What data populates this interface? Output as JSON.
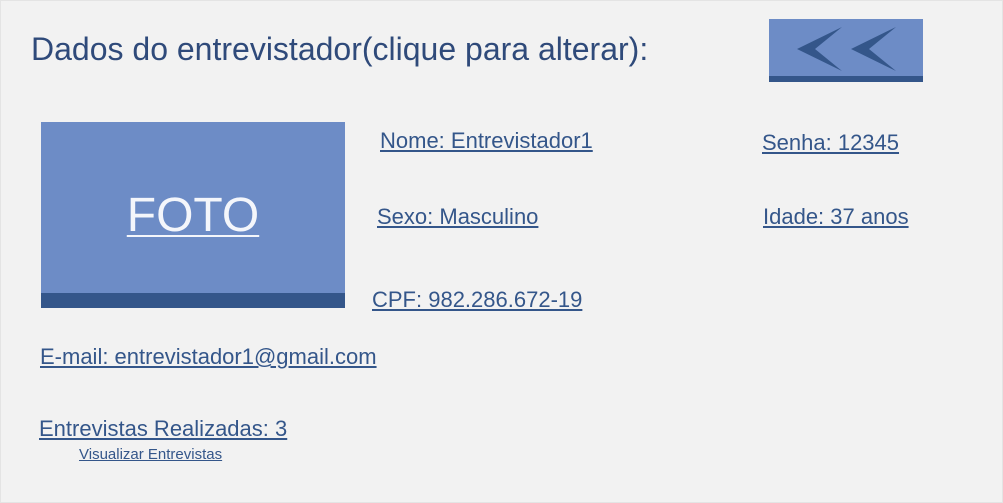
{
  "header": {
    "title": "Dados do entrevistador(clique para alterar):"
  },
  "back_button": {
    "icon": "double-chevron-left-icon"
  },
  "photo": {
    "label": "FOTO"
  },
  "fields": {
    "nome": "Nome: Entrevistador1",
    "senha": "Senha: 12345",
    "sexo": "Sexo: Masculino",
    "idade": "Idade: 37 anos",
    "cpf": "CPF: 982.286.672-19",
    "email": "E-mail: entrevistador1@gmail.com",
    "entrevistas": "Entrevistas Realizadas: 3"
  },
  "links": {
    "visualizar": "Visualizar Entrevistas"
  },
  "colors": {
    "accent": "#6d8cc6",
    "accent_dark": "#34568a",
    "text": "#2f4a7a",
    "background": "#f2f2f2"
  }
}
